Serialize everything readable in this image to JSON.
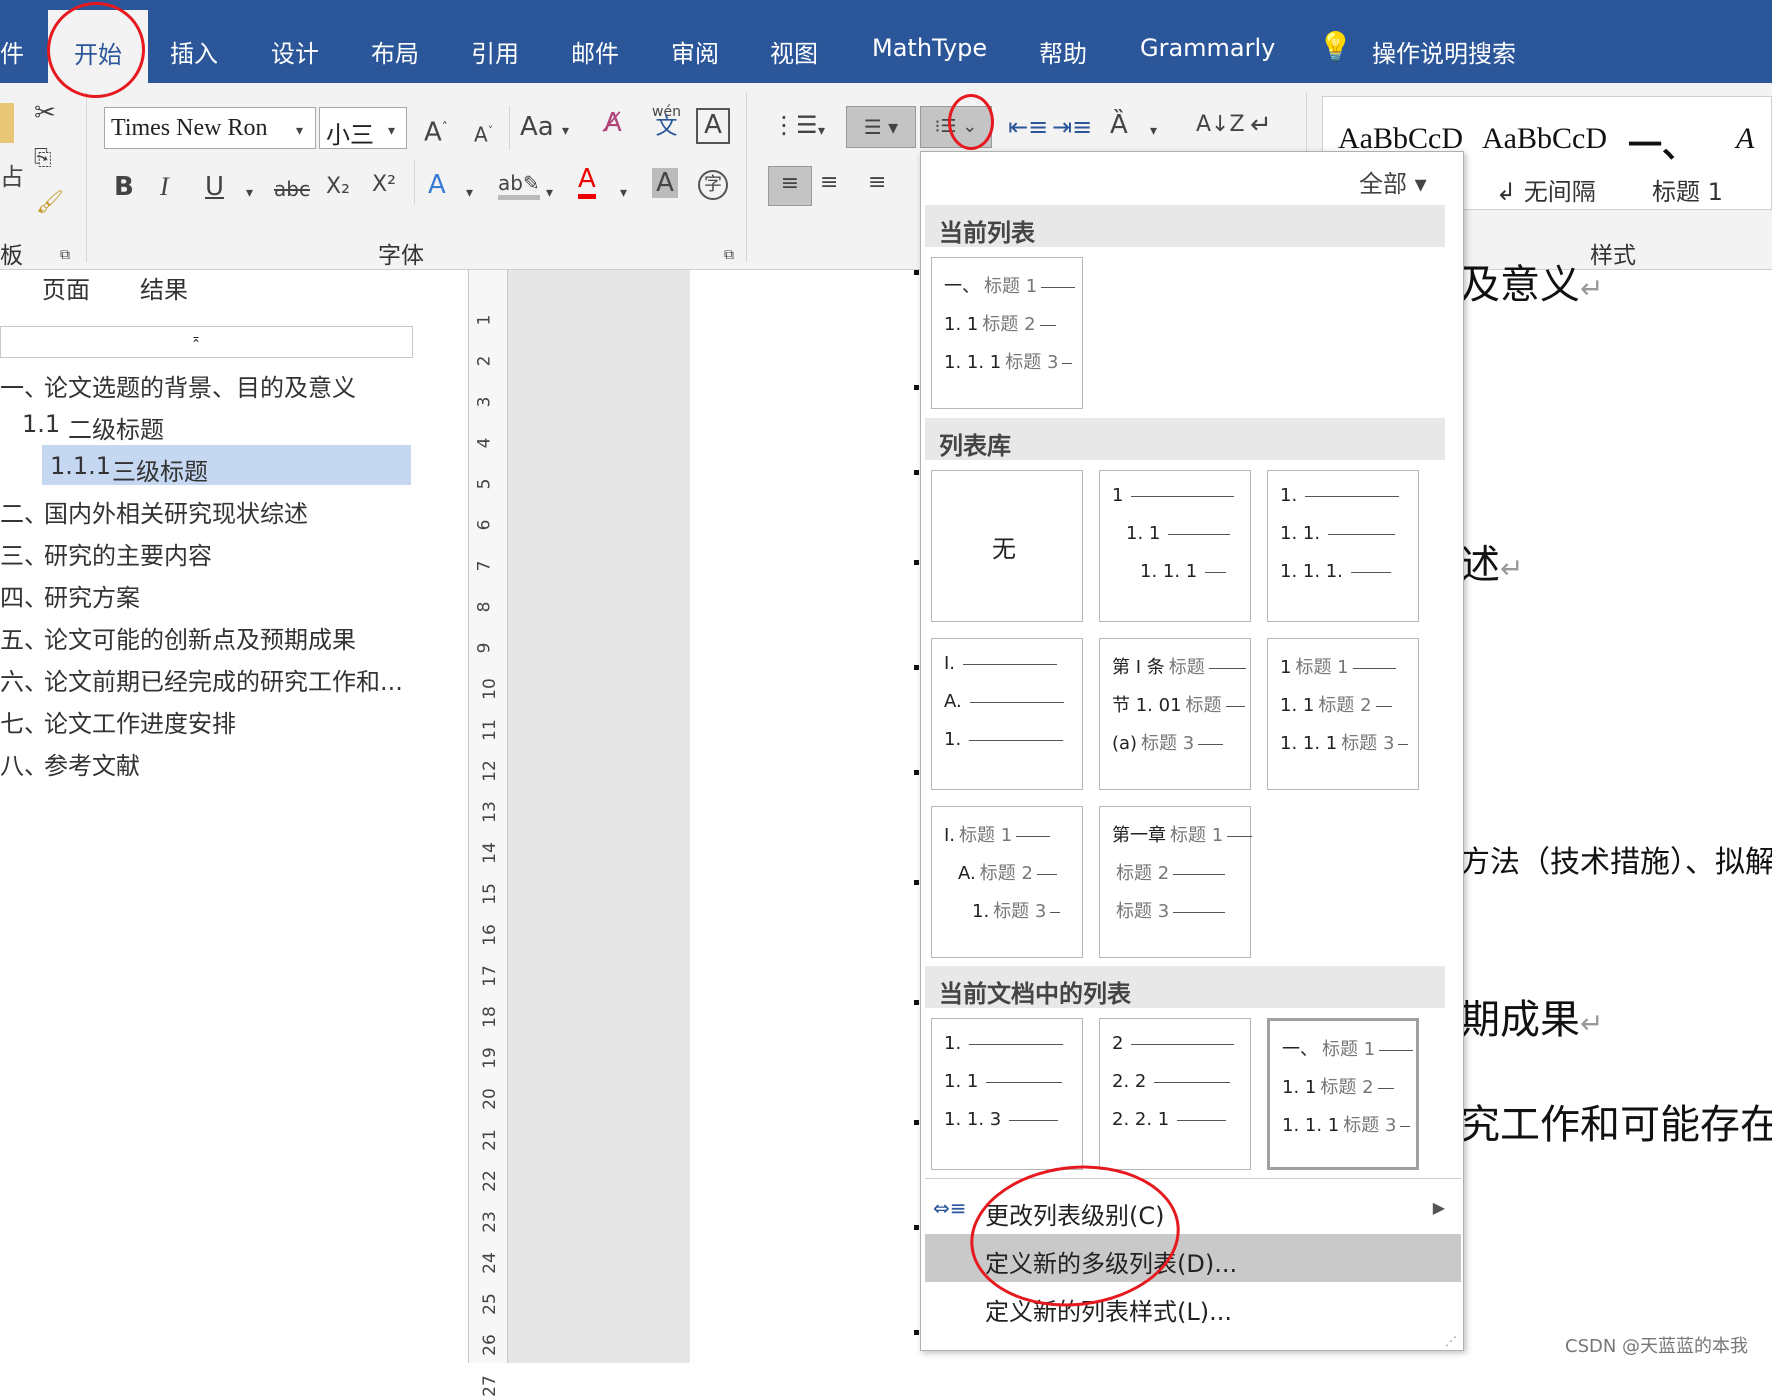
{
  "ribbon_tabs": {
    "file_partial": "件",
    "home": "开始",
    "insert": "插入",
    "design": "设计",
    "layout": "布局",
    "references": "引用",
    "mailings": "邮件",
    "review": "审阅",
    "view": "视图",
    "mathtype": "MathType",
    "help": "帮助",
    "grammarly": "Grammarly",
    "tell_me": "操作说明搜索"
  },
  "font": {
    "name": "Times New Ron",
    "size": "小三",
    "aa": "Aa",
    "wen": "wén",
    "wen_char": "文",
    "bold": "B",
    "italic": "I",
    "underline": "U",
    "strike": "abc",
    "subscript": "X₂",
    "superscript": "X²",
    "group_label": "字体"
  },
  "clipboard": {
    "paste_partial": "占",
    "group_label_partial": "板"
  },
  "styles": {
    "sample1": "AaBbCcD",
    "sample2": "AaBbCcD",
    "heading_sample": "一、",
    "name1": "无间隔",
    "name2": "标题 1",
    "group_label": "样式",
    "more_sample": "A"
  },
  "nav": {
    "tab_pages": "页面",
    "tab_results": "结果",
    "items": [
      {
        "num": "一、",
        "text": "论文选题的背景、目的及意义"
      },
      {
        "num": "1.1",
        "text": "二级标题"
      },
      {
        "num": "1.1.1",
        "text": "三级标题"
      },
      {
        "num": "二、",
        "text": "国内外相关研究现状综述"
      },
      {
        "num": "三、",
        "text": "研究的主要内容"
      },
      {
        "num": "四、",
        "text": "研究方案"
      },
      {
        "num": "五、",
        "text": "论文可能的创新点及预期成果"
      },
      {
        "num": "六、",
        "text": "论文前期已经完成的研究工作和..."
      },
      {
        "num": "七、",
        "text": "论文工作进度安排"
      },
      {
        "num": "八、",
        "text": "参考文献"
      }
    ]
  },
  "ruler_numbers": [
    "1",
    "2",
    "3",
    "4",
    "5",
    "6",
    "7",
    "8",
    "9",
    "10",
    "11",
    "12",
    "13",
    "14",
    "15",
    "16",
    "17",
    "18",
    "19",
    "20",
    "21",
    "22",
    "23",
    "24",
    "25",
    "26",
    "27"
  ],
  "document": {
    "line1": "及意义",
    "line2": "述",
    "line3": "方法（技术措施）、拟解",
    "line4": "期成果",
    "line5": "究工作和可能存在"
  },
  "dropdown": {
    "filter": "全部",
    "section_current": "当前列表",
    "section_library": "列表库",
    "section_doc": "当前文档中的列表",
    "none_label": "无",
    "menu_change_level": "更改列表级别(C)",
    "menu_define_new": "定义新的多级列表(D)...",
    "menu_define_style": "定义新的列表样式(L)..."
  },
  "list_cells": {
    "current": [
      [
        "一、",
        "标题 1"
      ],
      [
        "1. 1",
        "标题 2"
      ],
      [
        "1. 1. 1",
        "标题 3"
      ]
    ],
    "lib2": [
      [
        "1",
        ""
      ],
      [
        "1. 1",
        ""
      ],
      [
        "1. 1. 1",
        ""
      ]
    ],
    "lib3": [
      [
        "1.",
        ""
      ],
      [
        "1. 1.",
        ""
      ],
      [
        "1. 1. 1.",
        ""
      ]
    ],
    "lib4": [
      [
        "I.",
        ""
      ],
      [
        "A.",
        ""
      ],
      [
        "1.",
        ""
      ]
    ],
    "lib5": [
      [
        "第 I 条",
        "标题"
      ],
      [
        "节 1. 01",
        "标题"
      ],
      [
        "(a)",
        "标题 3"
      ]
    ],
    "lib6": [
      [
        "1",
        "标题 1"
      ],
      [
        "1. 1",
        "标题 2"
      ],
      [
        "1. 1. 1",
        "标题 3"
      ]
    ],
    "lib7": [
      [
        "I.",
        "标题 1"
      ],
      [
        "A.",
        "标题 2"
      ],
      [
        "1.",
        "标题 3"
      ]
    ],
    "lib8": [
      [
        "第一章",
        "标题 1"
      ],
      [
        "",
        "标题 2"
      ],
      [
        "",
        "标题 3"
      ]
    ],
    "doc1": [
      [
        "1.",
        ""
      ],
      [
        "1. 1",
        ""
      ],
      [
        "1. 1. 3",
        ""
      ]
    ],
    "doc2": [
      [
        "2",
        ""
      ],
      [
        "2. 2",
        ""
      ],
      [
        "2. 2. 1",
        ""
      ]
    ],
    "doc3": [
      [
        "一、",
        "标题 1"
      ],
      [
        "1. 1",
        "标题 2"
      ],
      [
        "1. 1. 1",
        "标题 3"
      ]
    ]
  },
  "watermark": "CSDN @天蓝蓝的本我"
}
